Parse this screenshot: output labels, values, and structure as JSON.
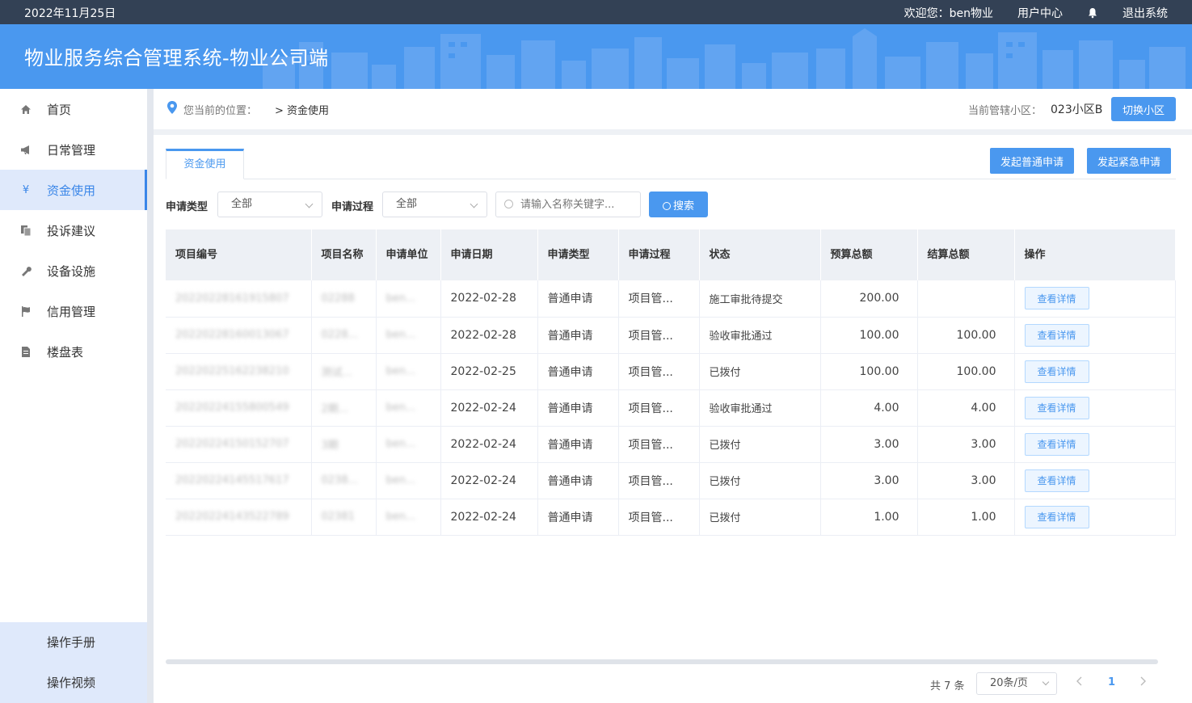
{
  "topbar": {
    "date": "2022年11月25日",
    "welcome": "欢迎您：ben物业",
    "user_center": "用户中心",
    "logout": "退出系统",
    "bell_icon": "bell-icon"
  },
  "header": {
    "title": "物业服务综合管理系统-物业公司端"
  },
  "sidebar": {
    "items": [
      {
        "label": "首页",
        "icon": "home-icon"
      },
      {
        "label": "日常管理",
        "icon": "megaphone-icon"
      },
      {
        "label": "资金使用",
        "icon": "yen-icon",
        "glyph": "¥",
        "active": true
      },
      {
        "label": "投诉建议",
        "icon": "document-copy-icon"
      },
      {
        "label": "设备设施",
        "icon": "wrench-icon"
      },
      {
        "label": "信用管理",
        "icon": "flag-icon"
      },
      {
        "label": "楼盘表",
        "icon": "file-icon"
      }
    ],
    "bottom": [
      "操作手册",
      "操作视频"
    ]
  },
  "breadcrumb": {
    "location_label": "您当前的位置：",
    "current": "> 资金使用",
    "community_label": "当前管辖小区：",
    "community": "023小区B",
    "switch_button": "切换小区"
  },
  "main": {
    "tab": "资金使用",
    "normal_apply_button": "发起普通申请",
    "urgent_apply_button": "发起紧急申请",
    "filters": {
      "type_label": "申请类型",
      "type_value": "全部",
      "process_label": "申请过程",
      "process_value": "全部",
      "search_placeholder": "请输入名称关键字...",
      "search_button": "搜索"
    },
    "columns": [
      "项目编号",
      "项目名称",
      "申请单位",
      "申请日期",
      "申请类型",
      "申请过程",
      "状态",
      "预算总额",
      "结算总额",
      "操作"
    ],
    "rows": [
      {
        "code": "20220228161915807",
        "name": "02288",
        "unit": "ben...",
        "date": "2022-02-28",
        "type": "普通申请",
        "process": "项目管...",
        "status": "施工审批待提交",
        "budget": "200.00",
        "settle": "",
        "action": "查看详情"
      },
      {
        "code": "20220228160013067",
        "name": "0228...",
        "unit": "ben...",
        "date": "2022-02-28",
        "type": "普通申请",
        "process": "项目管...",
        "status": "验收审批通过",
        "budget": "100.00",
        "settle": "100.00",
        "action": "查看详情"
      },
      {
        "code": "20220225162238210",
        "name": "测试...",
        "unit": "ben...",
        "date": "2022-02-25",
        "type": "普通申请",
        "process": "项目管...",
        "status": "已拨付",
        "budget": "100.00",
        "settle": "100.00",
        "action": "查看详情"
      },
      {
        "code": "20220224155800549",
        "name": "2期...",
        "unit": "ben...",
        "date": "2022-02-24",
        "type": "普通申请",
        "process": "项目管...",
        "status": "验收审批通过",
        "budget": "4.00",
        "settle": "4.00",
        "action": "查看详情"
      },
      {
        "code": "20220224150152707",
        "name": "3期",
        "unit": "ben...",
        "date": "2022-02-24",
        "type": "普通申请",
        "process": "项目管...",
        "status": "已拨付",
        "budget": "3.00",
        "settle": "3.00",
        "action": "查看详情"
      },
      {
        "code": "20220224145517617",
        "name": "0238...",
        "unit": "ben...",
        "date": "2022-02-24",
        "type": "普通申请",
        "process": "项目管...",
        "status": "已拨付",
        "budget": "3.00",
        "settle": "3.00",
        "action": "查看详情"
      },
      {
        "code": "20220224143522789",
        "name": "02381",
        "unit": "ben...",
        "date": "2022-02-24",
        "type": "普通申请",
        "process": "项目管...",
        "status": "已拨付",
        "budget": "1.00",
        "settle": "1.00",
        "action": "查看详情"
      }
    ]
  },
  "pagination": {
    "total": "共 7 条",
    "page_size": "20条/页",
    "current_page": "1",
    "prev_icon": "chevron-left-icon",
    "next_icon": "chevron-right-icon"
  },
  "colors": {
    "primary": "#4a98ef",
    "topbar": "#334155",
    "active_bg": "#dfe9fb"
  }
}
